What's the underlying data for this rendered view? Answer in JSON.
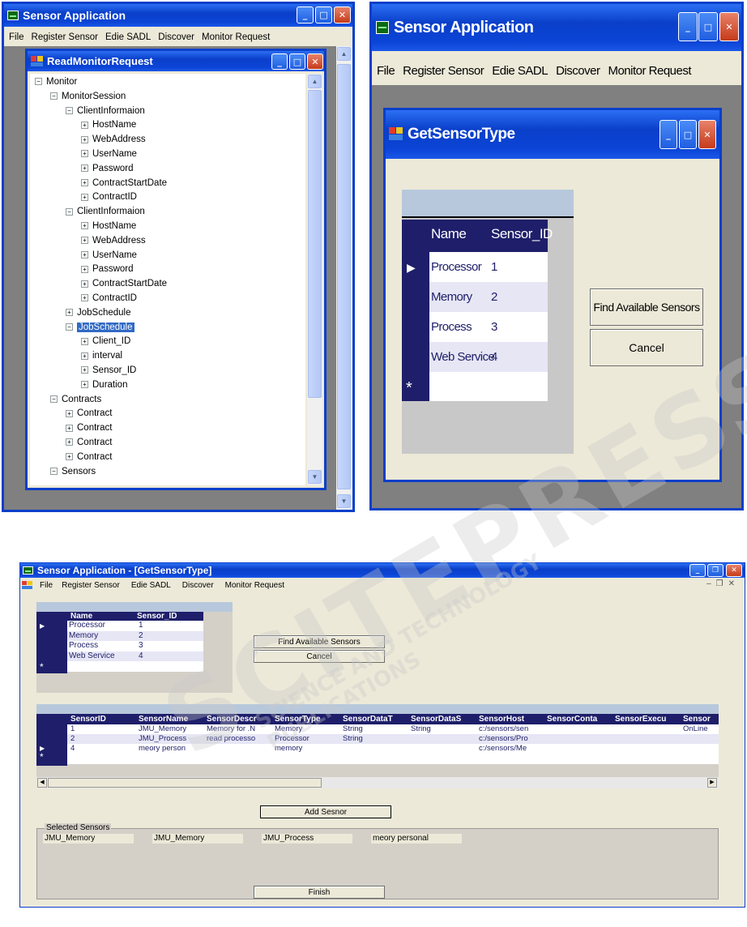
{
  "left_window": {
    "title": "Sensor Application",
    "menu": [
      "File",
      "Register Sensor",
      "Edie SADL",
      "Discover",
      "Monitor Request"
    ],
    "child_title": "ReadMonitorRequest",
    "tree": [
      {
        "label": "Monitor",
        "level": 0,
        "expander": "−"
      },
      {
        "label": "MonitorSession",
        "level": 1,
        "expander": "−"
      },
      {
        "label": "ClientInformaion",
        "level": 2,
        "expander": "−"
      },
      {
        "label": "HostName",
        "level": 3,
        "expander": "+"
      },
      {
        "label": "WebAddress",
        "level": 3,
        "expander": "+"
      },
      {
        "label": "UserName",
        "level": 3,
        "expander": "+"
      },
      {
        "label": "Password",
        "level": 3,
        "expander": "+"
      },
      {
        "label": "ContractStartDate",
        "level": 3,
        "expander": "+"
      },
      {
        "label": "ContractID",
        "level": 3,
        "expander": "+"
      },
      {
        "label": "ClientInformaion",
        "level": 2,
        "expander": "−"
      },
      {
        "label": "HostName",
        "level": 3,
        "expander": "+"
      },
      {
        "label": "WebAddress",
        "level": 3,
        "expander": "+"
      },
      {
        "label": "UserName",
        "level": 3,
        "expander": "+"
      },
      {
        "label": "Password",
        "level": 3,
        "expander": "+"
      },
      {
        "label": "ContractStartDate",
        "level": 3,
        "expander": "+"
      },
      {
        "label": "ContractID",
        "level": 3,
        "expander": "+"
      },
      {
        "label": "JobSchedule",
        "level": 2,
        "expander": "+"
      },
      {
        "label": "JobSchedule",
        "level": 2,
        "expander": "−",
        "selected": true
      },
      {
        "label": "Client_ID",
        "level": 3,
        "expander": "+"
      },
      {
        "label": "interval",
        "level": 3,
        "expander": "+"
      },
      {
        "label": "Sensor_ID",
        "level": 3,
        "expander": "+"
      },
      {
        "label": "Duration",
        "level": 3,
        "expander": "+"
      },
      {
        "label": "Contracts",
        "level": 1,
        "expander": "−"
      },
      {
        "label": "Contract",
        "level": 2,
        "expander": "+"
      },
      {
        "label": "Contract",
        "level": 2,
        "expander": "+"
      },
      {
        "label": "Contract",
        "level": 2,
        "expander": "+"
      },
      {
        "label": "Contract",
        "level": 2,
        "expander": "+"
      },
      {
        "label": "Sensors",
        "level": 1,
        "expander": "−"
      }
    ]
  },
  "right_window": {
    "title": "Sensor Application",
    "menu": [
      "File",
      "Register Sensor",
      "Edie SADL",
      "Discover",
      "Monitor Request"
    ],
    "child_title": "GetSensorType",
    "grid": {
      "headers": [
        "Name",
        "Sensor_ID"
      ],
      "rows": [
        [
          "Processor",
          "1"
        ],
        [
          "Memory",
          "2"
        ],
        [
          "Process",
          "3"
        ],
        [
          "Web Service",
          "4"
        ]
      ],
      "new_row_marker": "*"
    },
    "find_button": "Find Available Sensors",
    "cancel_button": "Cancel"
  },
  "bottom_window": {
    "title": "Sensor Application - [GetSensorType]",
    "menu": [
      "File",
      "Register Sensor",
      "Edie SADL",
      "Discover",
      "Monitor Request"
    ],
    "type_grid": {
      "headers": [
        "Name",
        "Sensor_ID"
      ],
      "rows": [
        [
          "Processor",
          "1"
        ],
        [
          "Memory",
          "2"
        ],
        [
          "Process",
          "3"
        ],
        [
          "Web Service",
          "4"
        ]
      ],
      "new_row_marker": "*"
    },
    "find_button": "Find Available Sensors",
    "cancel_button": "Cancel",
    "sensor_grid": {
      "headers": [
        "SensorID",
        "SensorName",
        "SensorDescr",
        "SensorType",
        "SensorDataT",
        "SensorDataS",
        "SensorHost",
        "SensorConta",
        "SensorExecu",
        "Sensor"
      ],
      "rows": [
        [
          "1",
          "JMU_Memory",
          "Memory for .N",
          "Memory",
          "String",
          "String",
          "c:/sensors/sen",
          "",
          "",
          "OnLine"
        ],
        [
          "2",
          "JMU_Process",
          "read processo",
          "Processor",
          "String",
          "",
          "c:/sensors/Pro",
          "",
          "",
          ""
        ],
        [
          "4",
          "meory person",
          "",
          "memory",
          "",
          "",
          "c:/sensors/Me",
          "",
          "",
          ""
        ]
      ],
      "new_row_marker": "*"
    },
    "add_button": "Add Sesnor",
    "selected_group_label": "Selected Sensors",
    "selected_items": [
      "JMU_Memory",
      "JMU_Memory",
      "JMU_Process",
      "meory personal"
    ],
    "finish_button": "Finish"
  },
  "watermark": [
    "SCITEPRESS",
    "SCIENCE AND TECHNOLOGY PUBLICATIONS"
  ]
}
